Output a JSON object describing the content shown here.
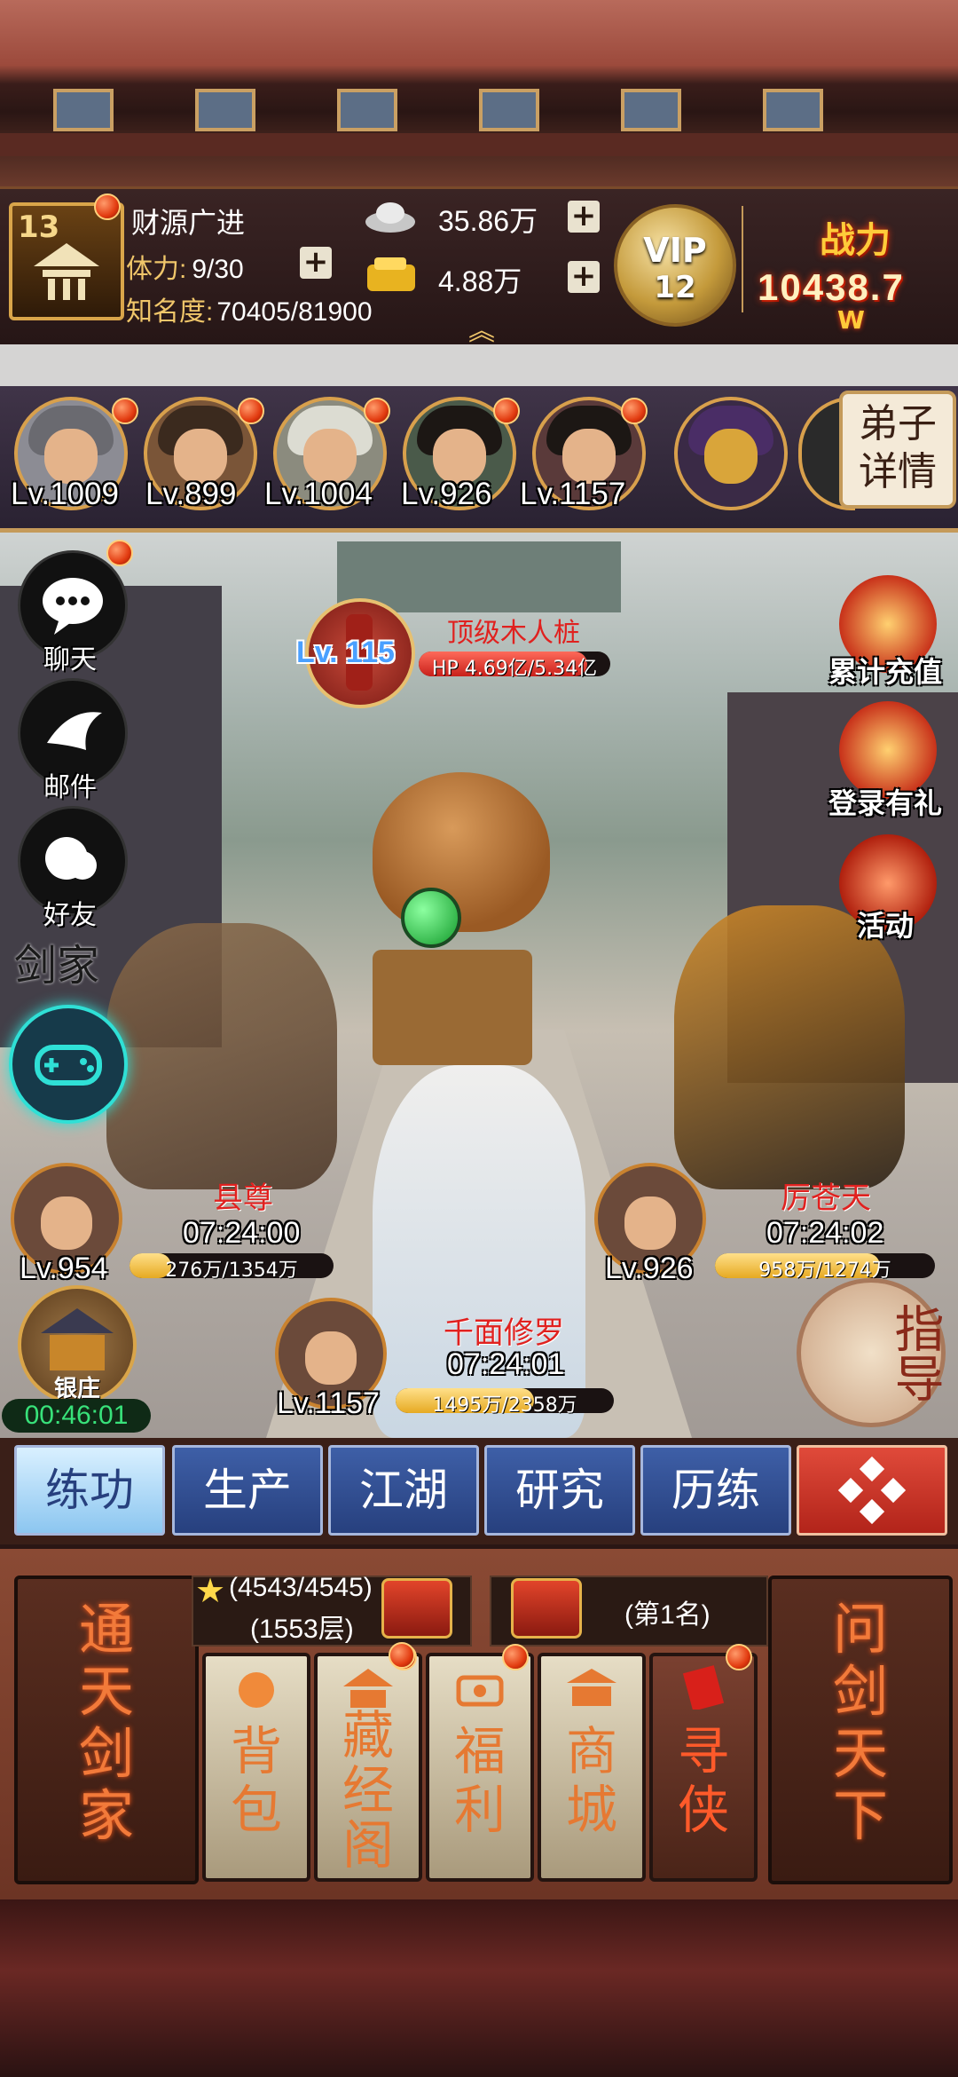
{
  "player": {
    "level": "13",
    "title": "财源广进",
    "stamina_label": "体力:",
    "stamina_value": "9/30",
    "fame_label": "知名度:",
    "fame_value": "70405/81900"
  },
  "currency": {
    "silver": "35.86万",
    "gold": "4.88万"
  },
  "vip": {
    "label": "VIP",
    "level": "12"
  },
  "power": {
    "label": "战力",
    "value": "1043",
    "unit": "8.7",
    "suffix": "W"
  },
  "disciples": [
    {
      "level": "Lv.1009"
    },
    {
      "level": "Lv.899"
    },
    {
      "level": "Lv.1004"
    },
    {
      "level": "Lv.926"
    },
    {
      "level": "Lv.1157"
    }
  ],
  "detail_button": {
    "line1": "弟子",
    "line2": "详情"
  },
  "left_menu": {
    "chat": "聊天",
    "mail": "邮件",
    "friends": "好友",
    "sword_clan": "剑家"
  },
  "right_menu": {
    "recharge": "累计充值",
    "login": "登录有礼",
    "activity": "活动"
  },
  "boss": {
    "level": "Lv. 115",
    "name": "顶级木人桩",
    "hp": "HP 4.69亿/5.34亿",
    "hp_fraction": 0.878
  },
  "fighters": [
    {
      "enemy": "县尊",
      "timer": "07:24:00",
      "level": "Lv.954",
      "hp": "276万/1354万",
      "hp_fraction": 0.204
    },
    {
      "enemy": "厉苍天",
      "timer": "07:24:02",
      "level": "Lv.926",
      "hp": "958万/1274万",
      "hp_fraction": 0.752
    },
    {
      "enemy": "千面修罗",
      "timer": "07:24:01",
      "level": "Lv.1157",
      "hp": "1495万/2358万",
      "hp_fraction": 0.634
    }
  ],
  "bank": {
    "label": "银庄",
    "timer": "00:46:01"
  },
  "guide": {
    "label": "指导"
  },
  "tabs": [
    "练功",
    "生产",
    "江湖",
    "研究",
    "历练"
  ],
  "tower": {
    "progress": "(4543/4545)",
    "floor": "(1553层)"
  },
  "rank": {
    "label": "(第1名)"
  },
  "big_cards": {
    "left": [
      "通",
      "天",
      "剑",
      "家"
    ],
    "right": [
      "问",
      "剑",
      "天",
      "下"
    ]
  },
  "small_cards": [
    {
      "chars": [
        "背",
        "包"
      ]
    },
    {
      "chars": [
        "藏",
        "经",
        "阁"
      ]
    },
    {
      "chars": [
        "福",
        "利"
      ]
    },
    {
      "chars": [
        "商",
        "城"
      ]
    },
    {
      "chars": [
        "寻",
        "侠"
      ]
    }
  ],
  "colors": {
    "accent_gold": "#d9a54a",
    "tab_blue": "#3e5fa7",
    "enemy_red": "#e0211f",
    "timer_green": "#38e27a"
  }
}
